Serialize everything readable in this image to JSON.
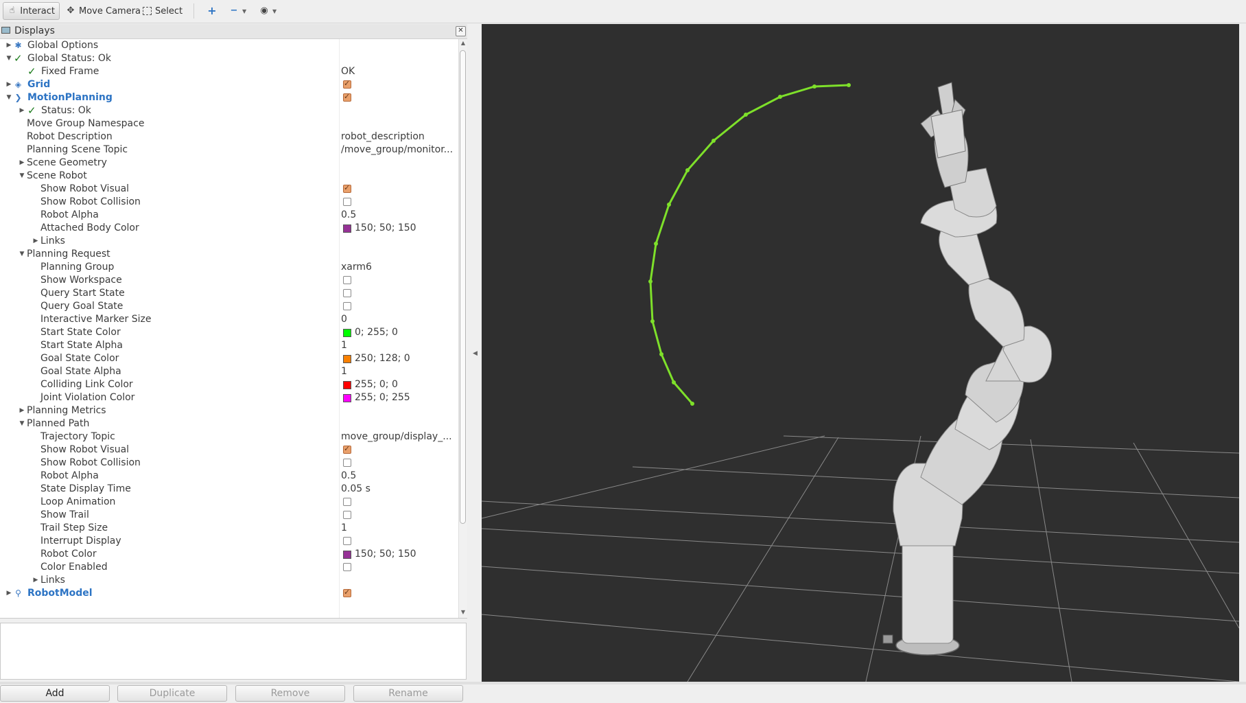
{
  "toolbar": {
    "tools": [
      {
        "label": "Interact",
        "icon": "hand-pointer-icon"
      },
      {
        "label": "Move Camera",
        "icon": "move-camera-icon"
      },
      {
        "label": "Select",
        "icon": "select-box-icon"
      }
    ],
    "extra_icons": [
      "add-tool-icon",
      "remove-tool-icon",
      "view-eye-icon"
    ]
  },
  "displays_panel": {
    "title": "Displays",
    "rows": [
      {
        "label": "Global Options",
        "value": ""
      },
      {
        "label": "Global Status: Ok",
        "value": ""
      },
      {
        "label": "Fixed Frame",
        "value": "OK"
      },
      {
        "label": "Grid",
        "value": "checked"
      },
      {
        "label": "MotionPlanning",
        "value": "checked"
      },
      {
        "label": "Status: Ok",
        "value": ""
      },
      {
        "label": "Move Group Namespace",
        "value": ""
      },
      {
        "label": "Robot Description",
        "value": "robot_description"
      },
      {
        "label": "Planning Scene Topic",
        "value": "/move_group/monitor..."
      },
      {
        "label": "Scene Geometry",
        "value": ""
      },
      {
        "label": "Scene Robot",
        "value": ""
      },
      {
        "label": "Show Robot Visual",
        "value": "checked"
      },
      {
        "label": "Show Robot Collision",
        "value": "unchecked"
      },
      {
        "label": "Robot Alpha",
        "value": "0.5"
      },
      {
        "label": "Attached Body Color",
        "value": "150; 50; 150",
        "color": "#963296"
      },
      {
        "label": "Links",
        "value": ""
      },
      {
        "label": "Planning Request",
        "value": ""
      },
      {
        "label": "Planning Group",
        "value": "xarm6"
      },
      {
        "label": "Show Workspace",
        "value": "unchecked"
      },
      {
        "label": "Query Start State",
        "value": "unchecked"
      },
      {
        "label": "Query Goal State",
        "value": "unchecked"
      },
      {
        "label": "Interactive Marker Size",
        "value": "0"
      },
      {
        "label": "Start State Color",
        "value": "0; 255; 0",
        "color": "#00ff00"
      },
      {
        "label": "Start State Alpha",
        "value": "1"
      },
      {
        "label": "Goal State Color",
        "value": "250; 128; 0",
        "color": "#fa8000"
      },
      {
        "label": "Goal State Alpha",
        "value": "1"
      },
      {
        "label": "Colliding Link Color",
        "value": "255; 0; 0",
        "color": "#ff0000"
      },
      {
        "label": "Joint Violation Color",
        "value": "255; 0; 255",
        "color": "#ff00ff"
      },
      {
        "label": "Planning Metrics",
        "value": ""
      },
      {
        "label": "Planned Path",
        "value": ""
      },
      {
        "label": "Trajectory Topic",
        "value": "move_group/display_..."
      },
      {
        "label": "Show Robot Visual",
        "value": "checked"
      },
      {
        "label": "Show Robot Collision",
        "value": "unchecked"
      },
      {
        "label": "Robot Alpha",
        "value": "0.5"
      },
      {
        "label": "State Display Time",
        "value": "0.05 s"
      },
      {
        "label": "Loop Animation",
        "value": "unchecked"
      },
      {
        "label": "Show Trail",
        "value": "unchecked"
      },
      {
        "label": "Trail Step Size",
        "value": "1"
      },
      {
        "label": "Interrupt Display",
        "value": "unchecked"
      },
      {
        "label": "Robot Color",
        "value": "150; 50; 150",
        "color": "#963296"
      },
      {
        "label": "Color Enabled",
        "value": "unchecked"
      },
      {
        "label": "Links",
        "value": ""
      },
      {
        "label": "RobotModel",
        "value": "checked"
      }
    ]
  },
  "panel_buttons": {
    "add": "Add",
    "duplicate": "Duplicate",
    "remove": "Remove",
    "rename": "Rename"
  },
  "viewport": {
    "background": "#2f2f2f",
    "trajectory_color": "#7ee02a",
    "grid_color": "#8a8a8a",
    "robot_color": "#d9d9d9"
  }
}
